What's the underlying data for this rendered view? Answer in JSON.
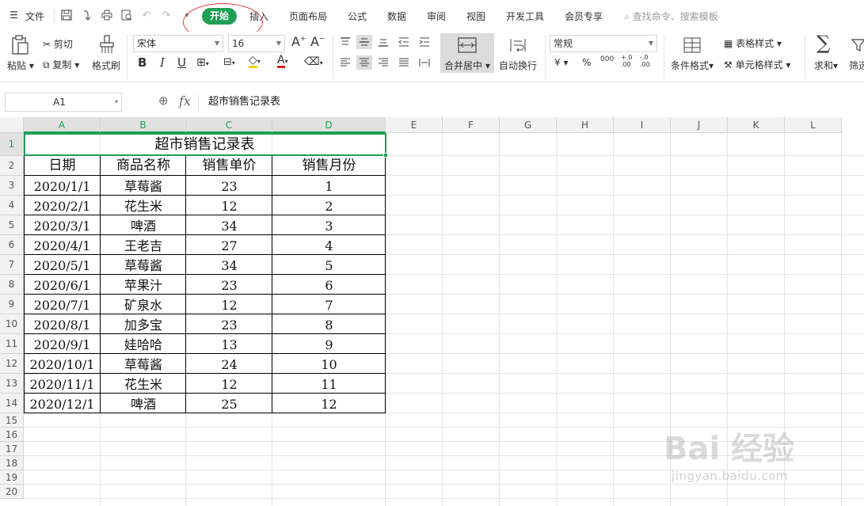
{
  "menu": {
    "file": "文件",
    "tabs": [
      "开始",
      "插入",
      "页面布局",
      "公式",
      "数据",
      "审阅",
      "视图",
      "开发工具",
      "会员专享"
    ],
    "active_tab": "开始",
    "search_placeholder": "查找命令、搜索模板"
  },
  "ribbon": {
    "paste": "粘贴",
    "cut": "剪切",
    "copy": "复制",
    "format_painter": "格式刷",
    "font_name": "宋体",
    "font_size": "16",
    "bold": "B",
    "italic": "I",
    "underline": "U",
    "font_color_glyph": "A",
    "merge_center": "合并居中",
    "wrap_text": "自动换行",
    "number_format": "常规",
    "currency": "¥",
    "percent": "%",
    "thousands": "000",
    "inc_decimal": "+.0 .00",
    "dec_decimal": "-.0 .00",
    "conditional_format": "条件格式",
    "table_style": "表格样式",
    "cell_style": "单元格样式",
    "sum": "求和",
    "filter": "筛选"
  },
  "formula_bar": {
    "name_box": "A1",
    "fx": "fx",
    "content": "超市销售记录表"
  },
  "grid": {
    "columns": [
      "A",
      "B",
      "C",
      "D",
      "E",
      "F",
      "G",
      "H",
      "I",
      "J",
      "K",
      "L"
    ],
    "rows": [
      "1",
      "2",
      "3",
      "4",
      "5",
      "6",
      "7",
      "8",
      "9",
      "10",
      "11",
      "12",
      "13",
      "14",
      "15",
      "16",
      "17",
      "18",
      "19",
      "20"
    ],
    "selected_cell": "A1"
  },
  "sheet": {
    "title": "超市销售记录表",
    "headers": [
      "日期",
      "商品名称",
      "销售单价",
      "销售月份"
    ],
    "rows": [
      [
        "2020/1/1",
        "草莓酱",
        "23",
        "1"
      ],
      [
        "2020/2/1",
        "花生米",
        "12",
        "2"
      ],
      [
        "2020/3/1",
        "啤酒",
        "34",
        "3"
      ],
      [
        "2020/4/1",
        "王老吉",
        "27",
        "4"
      ],
      [
        "2020/5/1",
        "草莓酱",
        "34",
        "5"
      ],
      [
        "2020/6/1",
        "苹果汁",
        "23",
        "6"
      ],
      [
        "2020/7/1",
        "矿泉水",
        "12",
        "7"
      ],
      [
        "2020/8/1",
        "加多宝",
        "23",
        "8"
      ],
      [
        "2020/9/1",
        "娃哈哈",
        "13",
        "9"
      ],
      [
        "2020/10/1",
        "草莓酱",
        "24",
        "10"
      ],
      [
        "2020/11/1",
        "花生米",
        "12",
        "11"
      ],
      [
        "2020/12/1",
        "啤酒",
        "25",
        "12"
      ]
    ]
  },
  "watermark": {
    "brand": "Bai 经验",
    "url": "jingyan.baidu.com"
  },
  "colors": {
    "accent_green": "#1e9f53",
    "annotation_red": "#e23a3a"
  }
}
